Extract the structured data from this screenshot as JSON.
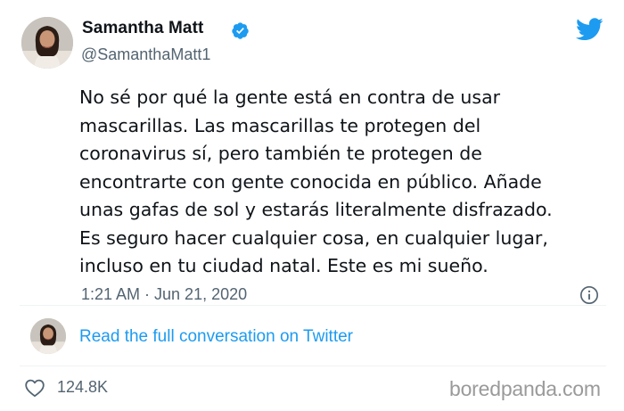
{
  "author": {
    "display_name": "Samantha Matt",
    "handle": "@SamanthaMatt1",
    "verified": true,
    "avatar_icon": "profile-photo"
  },
  "tweet": {
    "lines": [
      "No sé por qué la gente está en contra de usar",
      "mascarillas. Las mascarillas te protegen del",
      "coronavirus sí, pero también te protegen de",
      "encontrarte con gente conocida en público. Añade",
      "unas gafas de sol y estarás literalmente disfrazado.",
      "Es seguro hacer cualquier cosa, en cualquier lugar,",
      "incluso en tu ciudad natal. Este es mi sueño."
    ],
    "timestamp": "1:21 AM · Jun 21, 2020"
  },
  "conversation": {
    "link_label": "Read the full conversation on Twitter"
  },
  "stats": {
    "likes": "124.8K"
  },
  "watermark": "boredpanda.com",
  "icons": {
    "brand": "twitter-bird-icon",
    "verified": "verified-badge-icon",
    "info": "info-icon",
    "like": "heart-icon"
  },
  "colors": {
    "brand_blue": "#1d9bf0",
    "text_primary": "#0f1419",
    "text_secondary": "#536471",
    "divider": "#eff3f4",
    "watermark": "#9a9a9a"
  }
}
